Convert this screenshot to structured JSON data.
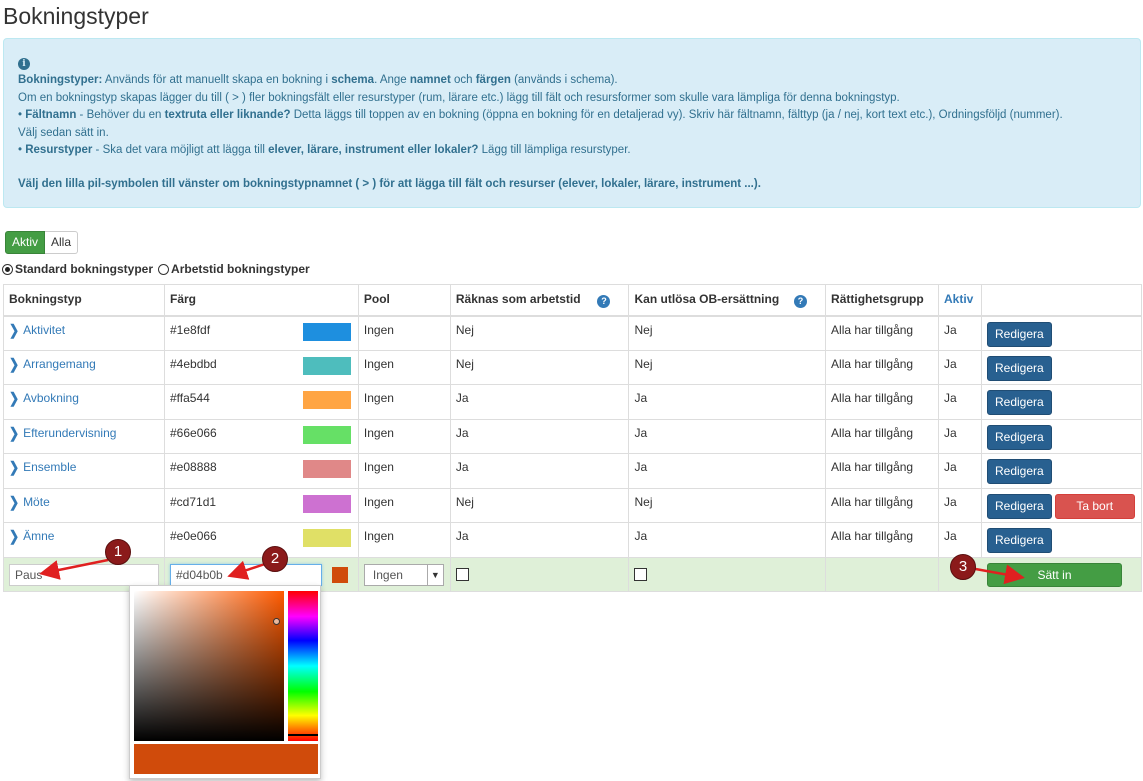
{
  "page": {
    "title": "Bokningstyper"
  },
  "info": {
    "line1_b1": "Bokningstyper:",
    "line1_t1": " Används för att manuellt skapa en bokning i ",
    "line1_b2": "schema",
    "line1_t2": ". Ange ",
    "line1_b3": "namnet",
    "line1_t3": " och ",
    "line1_b4": "färgen",
    "line1_t4": " (används i schema).",
    "line2": "Om en bokningstyp skapas lägger du till ( > ) fler bokningsfält eller resurstyper (rum, lärare etc.) lägg till fält och resursformer som skulle vara lämpliga för denna bokningstyp.",
    "line3_t1": "• ",
    "line3_b1": "Fältnamn",
    "line3_t2": " - Behöver du en ",
    "line3_b2": "textruta eller liknande?",
    "line3_t3": " Detta läggs till toppen av en bokning (öppna en bokning för en detaljerad vy). Skriv här fältnamn, fälttyp (ja / nej, kort text etc.), Ordningsföljd (nummer).",
    "line4": "Välj sedan sätt in.",
    "line5_t1": "• ",
    "line5_b1": "Resurstyper",
    "line5_t2": " - Ska det vara möjligt att lägga till ",
    "line5_b2": "elever, lärare, instrument eller lokaler?",
    "line5_t3": " Lägg till lämpliga resurstyper.",
    "line6": "Välj den lilla pil-symbolen till vänster om bokningstypnamnet ( > ) för att lägga till fält och resurser (elever, lokaler, lärare, instrument ...)."
  },
  "filter": {
    "active_label": "Aktiv",
    "all_label": "Alla"
  },
  "radios": {
    "standard": "Standard bokningstyper",
    "arbetstid": "Arbetstid bokningstyper"
  },
  "table": {
    "headers": {
      "type": "Bokningstyp",
      "color": "Färg",
      "pool": "Pool",
      "worktime": "Räknas som arbetstid",
      "ob": "Kan utlösa OB-ersättning",
      "rights": "Rättighetsgrupp",
      "active": "Aktiv"
    },
    "rows": [
      {
        "name": "Aktivitet",
        "color": "#1e8fdf",
        "pool": "Ingen",
        "worktime": "Nej",
        "ob": "Nej",
        "rights": "Alla har tillgång",
        "active": "Ja",
        "edit": "Redigera"
      },
      {
        "name": "Arrangemang",
        "color": "#4ebdbd",
        "pool": "Ingen",
        "worktime": "Nej",
        "ob": "Nej",
        "rights": "Alla har tillgång",
        "active": "Ja",
        "edit": "Redigera"
      },
      {
        "name": "Avbokning",
        "color": "#ffa544",
        "pool": "Ingen",
        "worktime": "Ja",
        "ob": "Ja",
        "rights": "Alla har tillgång",
        "active": "Ja",
        "edit": "Redigera"
      },
      {
        "name": "Efterundervisning",
        "color": "#66e066",
        "pool": "Ingen",
        "worktime": "Ja",
        "ob": "Ja",
        "rights": "Alla har tillgång",
        "active": "Ja",
        "edit": "Redigera"
      },
      {
        "name": "Ensemble",
        "color": "#e08888",
        "pool": "Ingen",
        "worktime": "Ja",
        "ob": "Ja",
        "rights": "Alla har tillgång",
        "active": "Ja",
        "edit": "Redigera"
      },
      {
        "name": "Möte",
        "color": "#cd71d1",
        "pool": "Ingen",
        "worktime": "Nej",
        "ob": "Nej",
        "rights": "Alla har tillgång",
        "active": "Ja",
        "edit": "Redigera",
        "delete": "Ta bort"
      },
      {
        "name": "Ämne",
        "color": "#e0e066",
        "pool": "Ingen",
        "worktime": "Ja",
        "ob": "Ja",
        "rights": "Alla har tillgång",
        "active": "Ja",
        "edit": "Redigera"
      }
    ],
    "new_row": {
      "name_value": "Paus",
      "color_value": "#d04b0b",
      "color_swatch": "#d04b0b",
      "pool_value": "Ingen",
      "insert_label": "Sätt in"
    }
  },
  "picker": {
    "selected_color": "#d04b0b",
    "hue_color": "#ff5a00"
  },
  "callouts": {
    "one": "1",
    "two": "2",
    "three": "3"
  },
  "colors": {
    "callout": "#8b1a1a",
    "arrow": "#e02020",
    "info_bg": "#d9edf7",
    "link": "#337ab7"
  }
}
